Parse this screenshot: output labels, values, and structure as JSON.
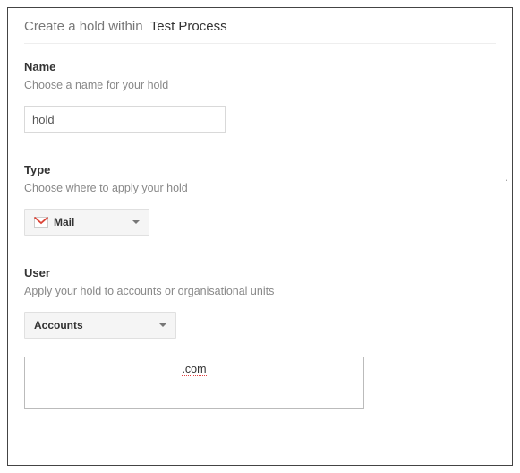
{
  "header": {
    "prefix": "Create a hold within",
    "matter": "Test Process"
  },
  "name_section": {
    "title": "Name",
    "subtitle": "Choose a name for your hold",
    "value": "hold"
  },
  "type_section": {
    "title": "Type",
    "subtitle": "Choose where to apply your hold",
    "selected": "Mail"
  },
  "user_section": {
    "title": "User",
    "subtitle": "Apply your hold to accounts or organisational units",
    "selected": "Accounts",
    "accounts_value": ".com"
  }
}
